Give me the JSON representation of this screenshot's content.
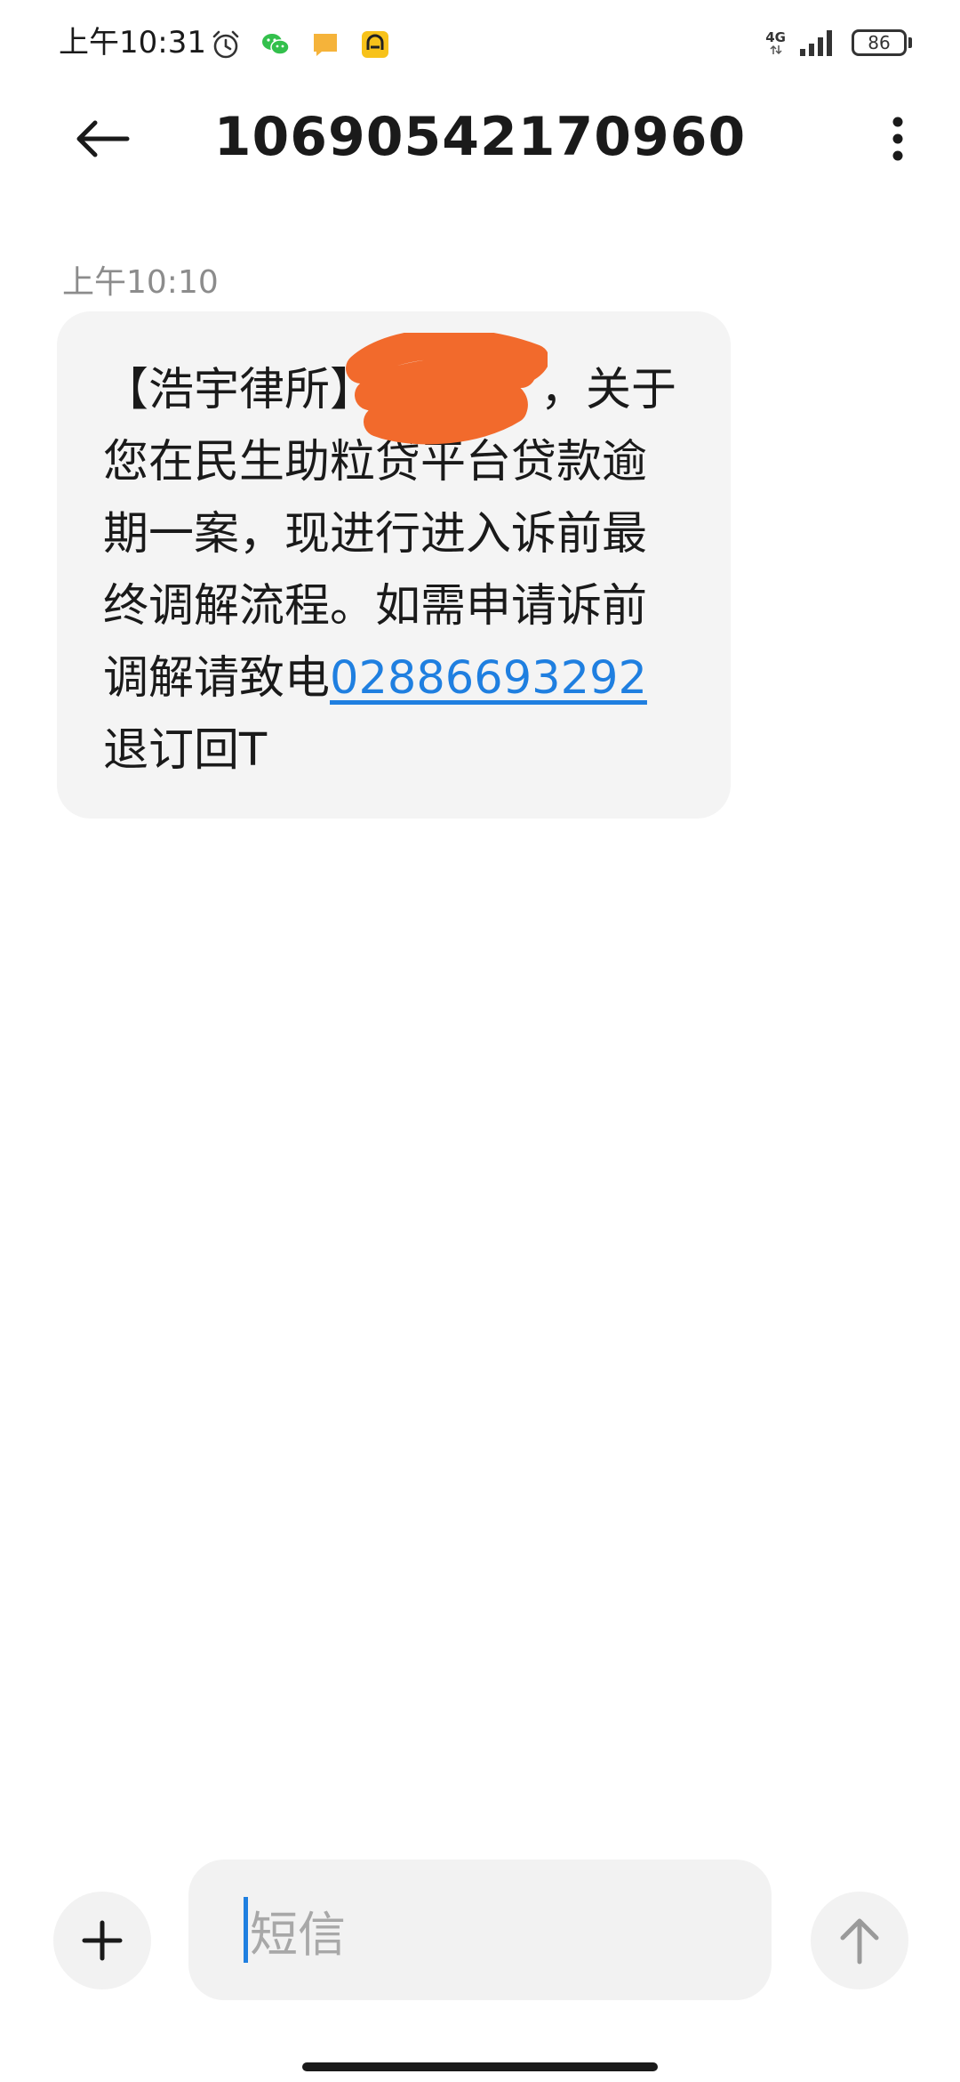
{
  "status_bar": {
    "time": "上午10:31",
    "network": "4G",
    "battery": "86",
    "icons": [
      "alarm-icon",
      "wechat-icon",
      "notification-icon",
      "app-notification-icon",
      "signal-icon",
      "battery-icon"
    ]
  },
  "header": {
    "title": "10690542170960",
    "back_icon": "back-arrow-icon",
    "more_icon": "more-vertical-icon"
  },
  "conversation": {
    "timestamp": "上午10:10",
    "message": {
      "text_before_link": "【浩宇律所】",
      "text_after_redaction": "，关于您在民生助粒贷平台贷款逾期一案，现进行进入诉前最终调解流程。如需申请诉前调解请致电",
      "phone_link": "02886693292",
      "text_after_link": "退订回T"
    }
  },
  "composer": {
    "placeholder": "短信",
    "add_icon": "plus-icon",
    "send_icon": "send-arrow-icon"
  },
  "colors": {
    "link": "#1f7fe0",
    "bubble": "#f4f4f4",
    "redaction": "#f26a2c"
  }
}
